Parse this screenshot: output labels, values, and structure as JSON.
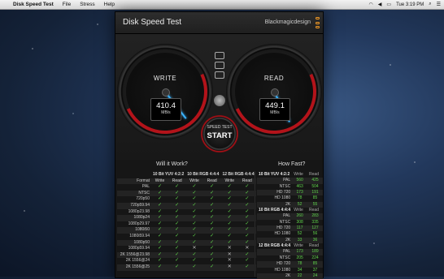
{
  "menubar": {
    "apple": "",
    "app": "Disk Speed Test",
    "items": [
      "File",
      "Stress",
      "Help"
    ],
    "clock": "Tue 3:19 PM"
  },
  "window": {
    "title": "Disk Speed Test",
    "brand": "Blackmagicdesign"
  },
  "write_gauge": {
    "label": "WRITE",
    "value": "410.4",
    "unit": "MB/s",
    "needle_fraction": 0.36
  },
  "read_gauge": {
    "label": "READ",
    "value": "449.1",
    "unit": "MB/s",
    "needle_fraction": 0.4
  },
  "start_button": {
    "top": "SPEED TEST",
    "main": "START"
  },
  "will_it_work": {
    "title": "Will it Work?",
    "groups": [
      "10 Bit YUV 4:2:2",
      "10 Bit RGB 4:4:4",
      "12 Bit RGB 4:4:4"
    ],
    "col_format": "Format",
    "col_write": "Write",
    "col_read": "Read",
    "rows": [
      {
        "format": "PAL",
        "cells": [
          "y",
          "y",
          "y",
          "y",
          "y",
          "y"
        ]
      },
      {
        "format": "NTSC",
        "cells": [
          "y",
          "y",
          "y",
          "y",
          "y",
          "y"
        ]
      },
      {
        "format": "720p50",
        "cells": [
          "y",
          "y",
          "y",
          "y",
          "y",
          "y"
        ]
      },
      {
        "format": "720p59.94",
        "cells": [
          "y",
          "y",
          "y",
          "y",
          "y",
          "y"
        ]
      },
      {
        "format": "1080p23.98",
        "cells": [
          "y",
          "y",
          "y",
          "y",
          "y",
          "y"
        ]
      },
      {
        "format": "1080p24",
        "cells": [
          "y",
          "y",
          "y",
          "y",
          "y",
          "y"
        ]
      },
      {
        "format": "1080p29.97",
        "cells": [
          "y",
          "y",
          "y",
          "y",
          "y",
          "y"
        ]
      },
      {
        "format": "1080i50",
        "cells": [
          "y",
          "y",
          "y",
          "y",
          "y",
          "y"
        ]
      },
      {
        "format": "1080i59.94",
        "cells": [
          "y",
          "y",
          "y",
          "y",
          "y",
          "y"
        ]
      },
      {
        "format": "1080p50",
        "cells": [
          "y",
          "y",
          "y",
          "y",
          "y",
          "y"
        ]
      },
      {
        "format": "1080p59.94",
        "cells": [
          "y",
          "y",
          "x",
          "y",
          "x",
          "x"
        ]
      },
      {
        "format": "2K 1556@23.98",
        "cells": [
          "y",
          "y",
          "y",
          "y",
          "x",
          "y"
        ]
      },
      {
        "format": "2K 1556@24",
        "cells": [
          "y",
          "y",
          "y",
          "y",
          "x",
          "y"
        ]
      },
      {
        "format": "2K 1556@25",
        "cells": [
          "y",
          "y",
          "y",
          "y",
          "x",
          "y"
        ]
      }
    ]
  },
  "how_fast": {
    "title": "How Fast?",
    "col_write": "Write",
    "col_read": "Read",
    "sections": [
      {
        "name": "10 Bit YUV 4:2:2",
        "rows": [
          [
            "PAL",
            "560",
            "425"
          ],
          [
            "NTSC",
            "463",
            "504"
          ],
          [
            "HD 720",
            "173",
            "191"
          ],
          [
            "HD 1080",
            "78",
            "85"
          ],
          [
            "2K",
            "52",
            "55"
          ]
        ]
      },
      {
        "name": "10 Bit RGB 4:4:4",
        "rows": [
          [
            "PAL",
            "260",
            "283"
          ],
          [
            "NTSC",
            "308",
            "335"
          ],
          [
            "HD 720",
            "117",
            "127"
          ],
          [
            "HD 1080",
            "52",
            "56"
          ],
          [
            "2K",
            "33",
            "36"
          ]
        ]
      },
      {
        "name": "12 Bit RGB 4:4:4",
        "rows": [
          [
            "PAL",
            "173",
            "189"
          ],
          [
            "NTSC",
            "205",
            "224"
          ],
          [
            "HD 720",
            "78",
            "85"
          ],
          [
            "HD 1080",
            "34",
            "37"
          ],
          [
            "2K",
            "22",
            "24"
          ]
        ]
      }
    ]
  }
}
